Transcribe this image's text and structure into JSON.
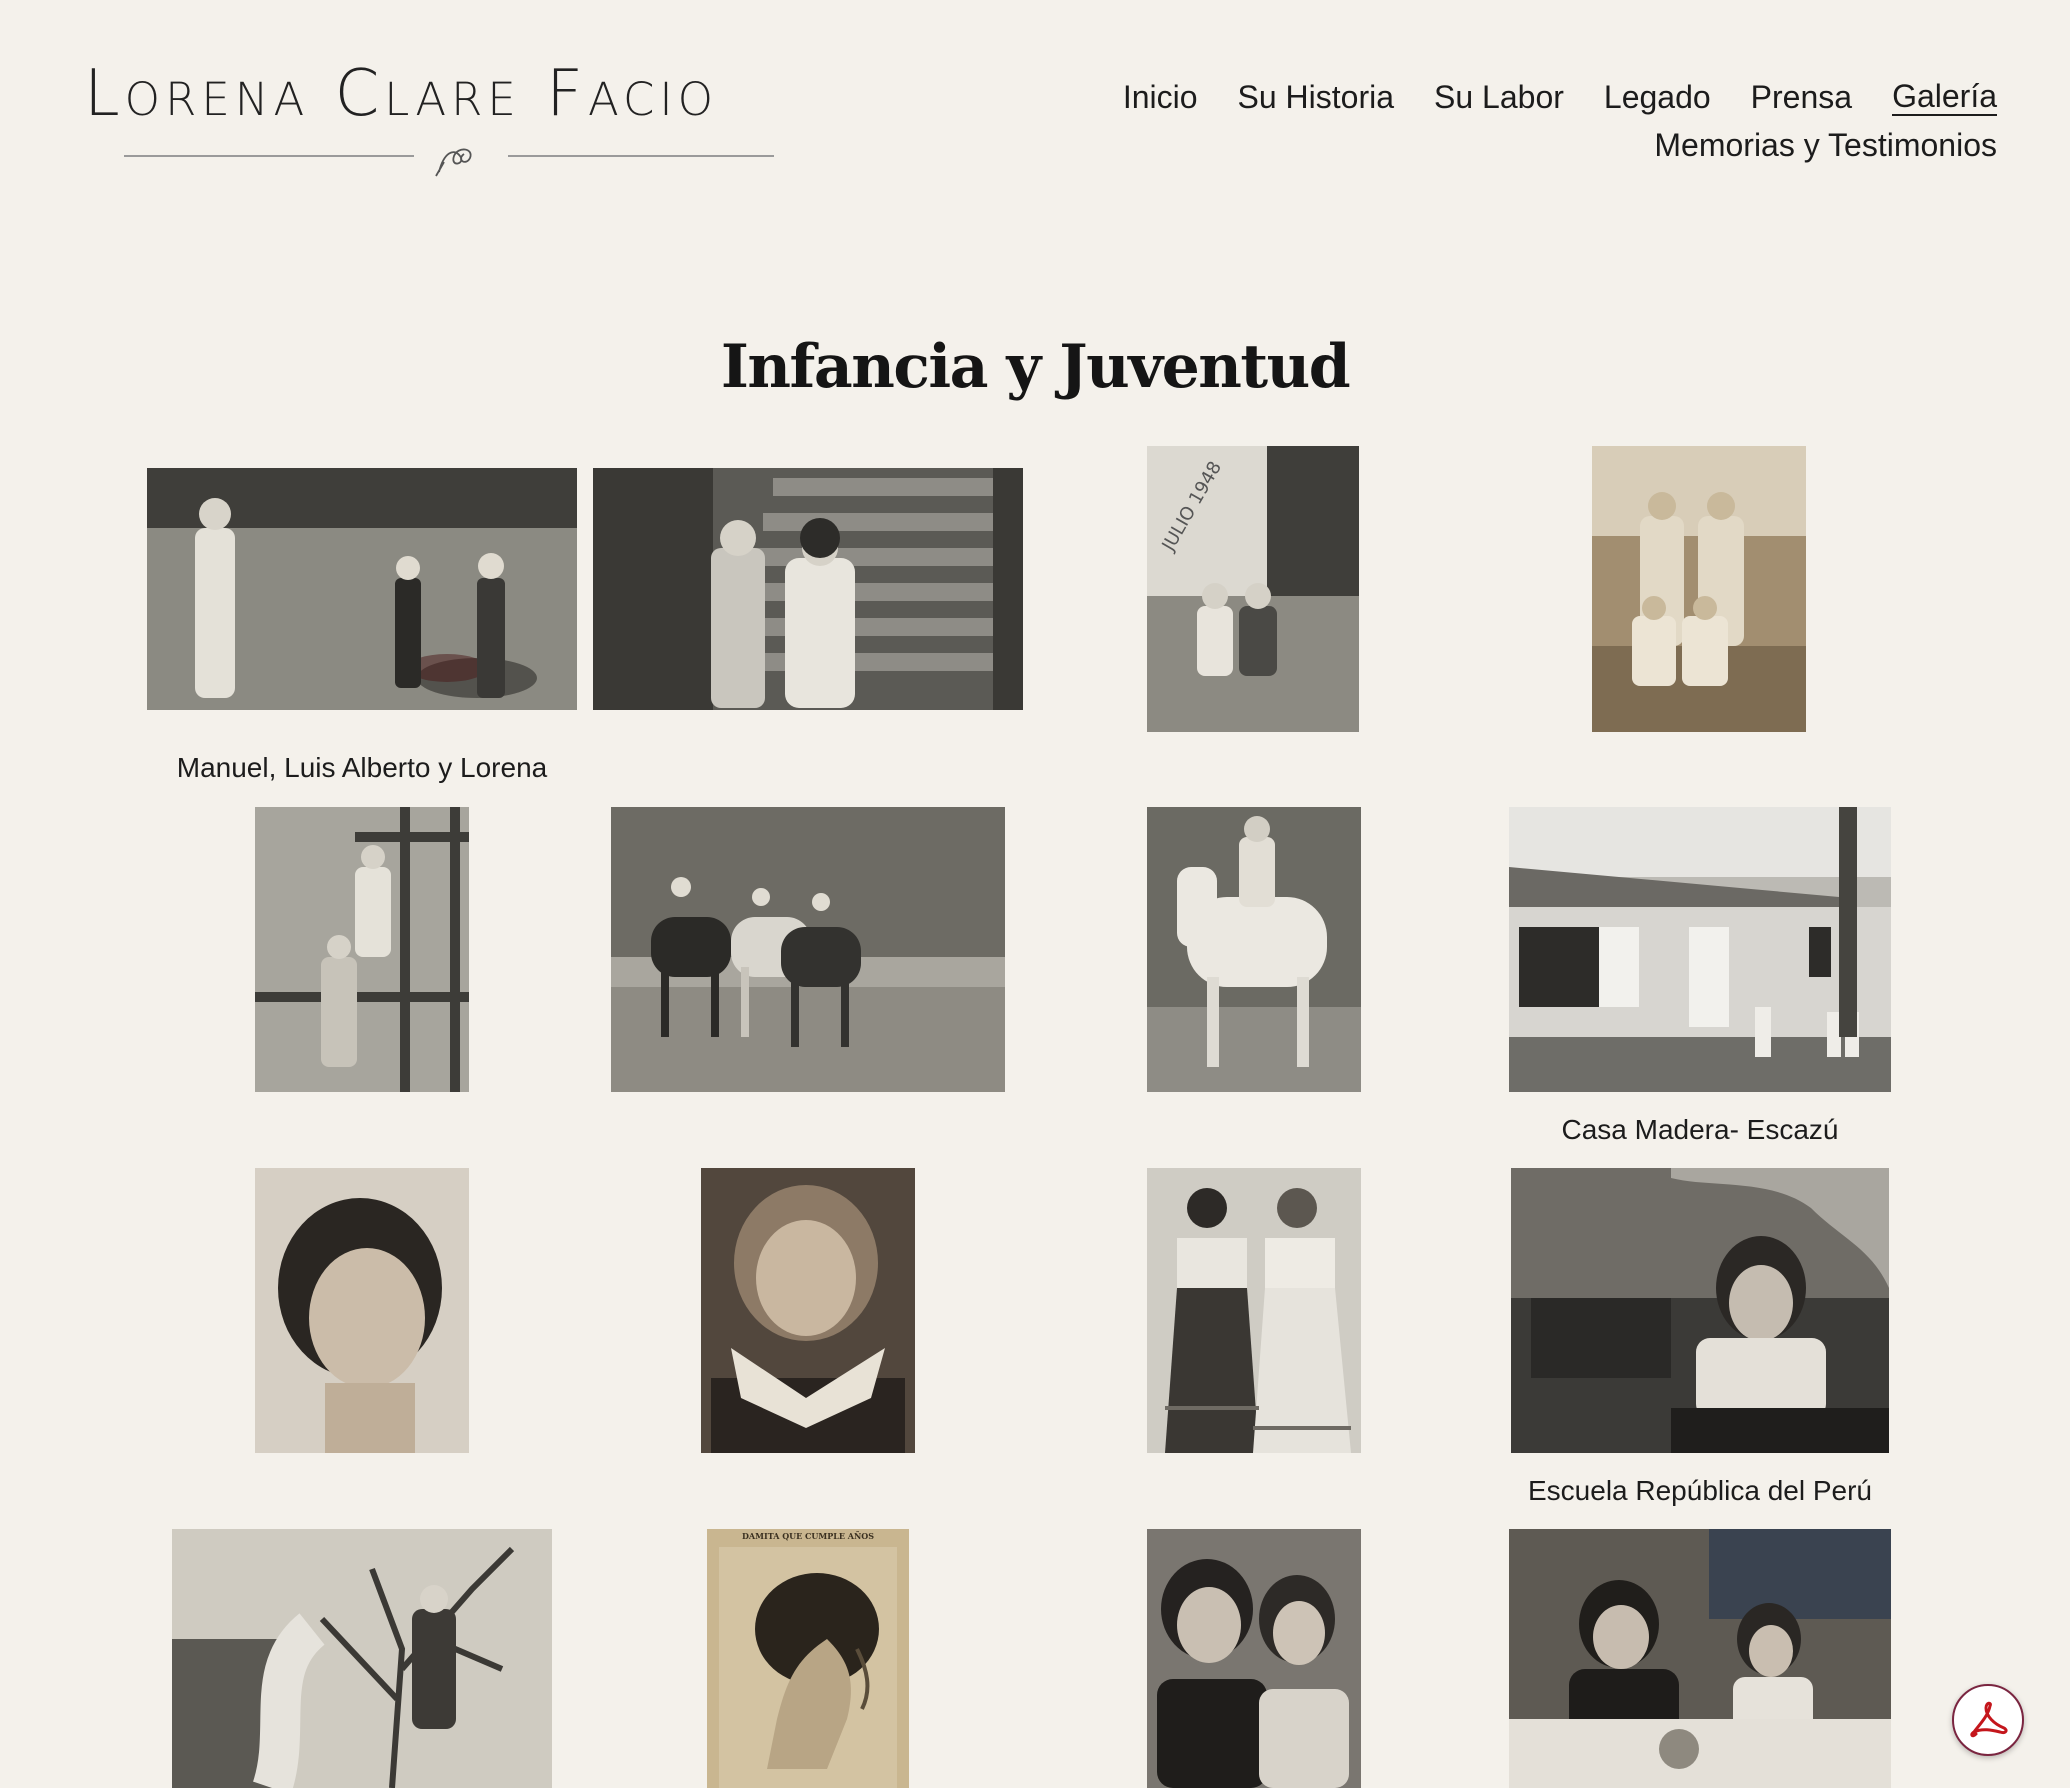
{
  "site": {
    "logo_text": "Lorena Clare Facio",
    "logo_monogram": "LC"
  },
  "nav": {
    "row1": [
      "Inicio",
      "Su Historia",
      "Su Labor",
      "Legado",
      "Prensa",
      "Galería"
    ],
    "row2": [
      "Memorias y Testimonios"
    ],
    "active": "Galería"
  },
  "page": {
    "title": "Infancia y Juventud"
  },
  "gallery": {
    "captions": [
      "Manuel, Luis Alberto y Lorena",
      "Casa Madera- Escazú",
      "Escuela República del Perú"
    ],
    "photos": [
      {
        "name": "photo-three-children-lawn",
        "tone": "#6f6e68"
      },
      {
        "name": "photo-two-children-stairs",
        "tone": "#5f5e58"
      },
      {
        "name": "photo-julio-1948",
        "tone": "#8a877f"
      },
      {
        "name": "photo-four-children-field",
        "tone": "#8c7a62"
      },
      {
        "name": "photo-children-ladder",
        "tone": "#6d6b64"
      },
      {
        "name": "photo-horses-riders",
        "tone": "#75726a"
      },
      {
        "name": "photo-girl-on-white-horse",
        "tone": "#6b6a63"
      },
      {
        "name": "photo-casa-madera",
        "tone": "#8e8d88"
      },
      {
        "name": "photo-young-girl-portrait",
        "tone": "#9b8d7d"
      },
      {
        "name": "photo-girl-lace-collar",
        "tone": "#6a5e52"
      },
      {
        "name": "photo-two-girls-costume",
        "tone": "#7d7a74"
      },
      {
        "name": "photo-girl-at-school-desk",
        "tone": "#5a5854"
      },
      {
        "name": "photo-girl-in-tree",
        "tone": "#8e8a80"
      },
      {
        "name": "photo-newspaper-profile",
        "tone": "#a99778"
      },
      {
        "name": "photo-mother-daughter",
        "tone": "#5c5955"
      },
      {
        "name": "photo-mother-daughter-table",
        "tone": "#605c55"
      }
    ],
    "newspaper_heading": "DAMITA QUE CUMPLE AÑOS",
    "photo_inscription": "JULIO 1948"
  },
  "colors": {
    "background": "#f4f1eb",
    "text": "#1c1c1c",
    "pdf_accent": "#c4161c"
  }
}
